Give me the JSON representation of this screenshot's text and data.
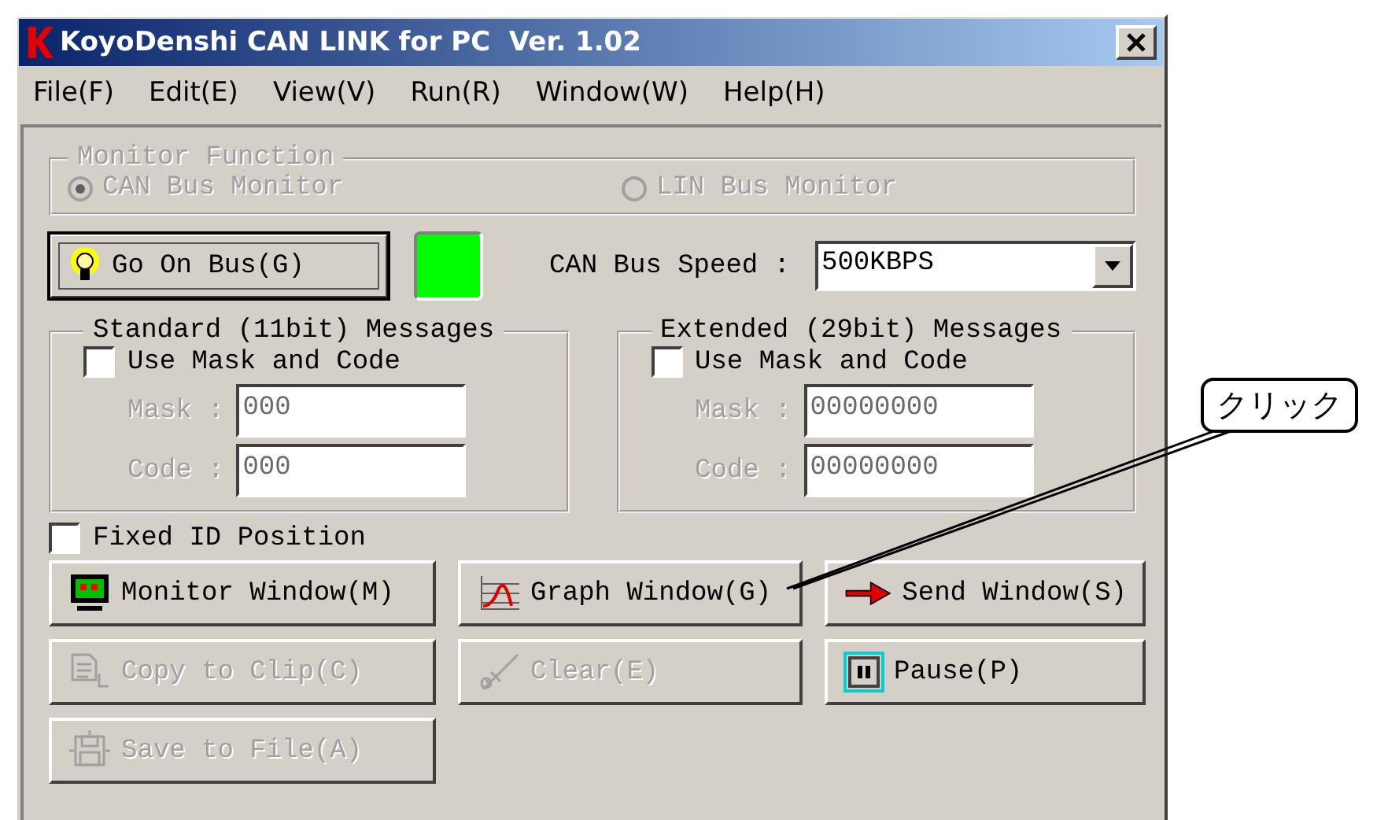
{
  "window": {
    "title": "KoyoDenshi CAN LINK for PC  Ver. 1.02"
  },
  "menu": [
    {
      "label": "File(F)"
    },
    {
      "label": "Edit(E)"
    },
    {
      "label": "View(V)"
    },
    {
      "label": "Run(R)"
    },
    {
      "label": "Window(W)"
    },
    {
      "label": "Help(H)"
    }
  ],
  "monitor_function": {
    "title": "Monitor Function",
    "disabled": true,
    "options": [
      {
        "label": "CAN Bus Monitor",
        "selected": true
      },
      {
        "label": "LIN Bus Monitor",
        "selected": false
      }
    ]
  },
  "go_on_bus": {
    "label": "Go On Bus(G)",
    "focused": true
  },
  "bus_indicator": {
    "on": true
  },
  "bus_speed": {
    "label": "CAN Bus Speed :",
    "value": "500KBPS"
  },
  "message_groups": [
    {
      "title": "Standard (11bit) Messages",
      "use_mask": {
        "label": "Use Mask and Code",
        "checked": false
      },
      "fields": [
        {
          "label": "Mask :",
          "value": "000",
          "disabled": true
        },
        {
          "label": "Code :",
          "value": "000",
          "disabled": true
        }
      ]
    },
    {
      "title": "Extended (29bit) Messages",
      "use_mask": {
        "label": "Use Mask and Code",
        "checked": false
      },
      "fields": [
        {
          "label": "Mask :",
          "value": "00000000",
          "disabled": true
        },
        {
          "label": "Code :",
          "value": "00000000",
          "disabled": true
        }
      ]
    }
  ],
  "fixed_id": {
    "label": "Fixed ID Position",
    "checked": false
  },
  "buttons": [
    {
      "label": "Monitor Window(M)",
      "kind": "monitor",
      "disabled": false
    },
    {
      "label": "Graph Window(G)",
      "kind": "graph",
      "disabled": false
    },
    {
      "label": "Send Window(S)",
      "kind": "send",
      "disabled": false
    },
    {
      "label": "Copy to Clip(C)",
      "kind": "copy",
      "disabled": true
    },
    {
      "label": "Clear(E)",
      "kind": "clear",
      "disabled": true
    },
    {
      "label": "Pause(P)",
      "kind": "pause",
      "disabled": false
    },
    {
      "label": "Save to File(A)",
      "kind": "save",
      "disabled": true
    }
  ],
  "callout": {
    "text": "クリック"
  }
}
